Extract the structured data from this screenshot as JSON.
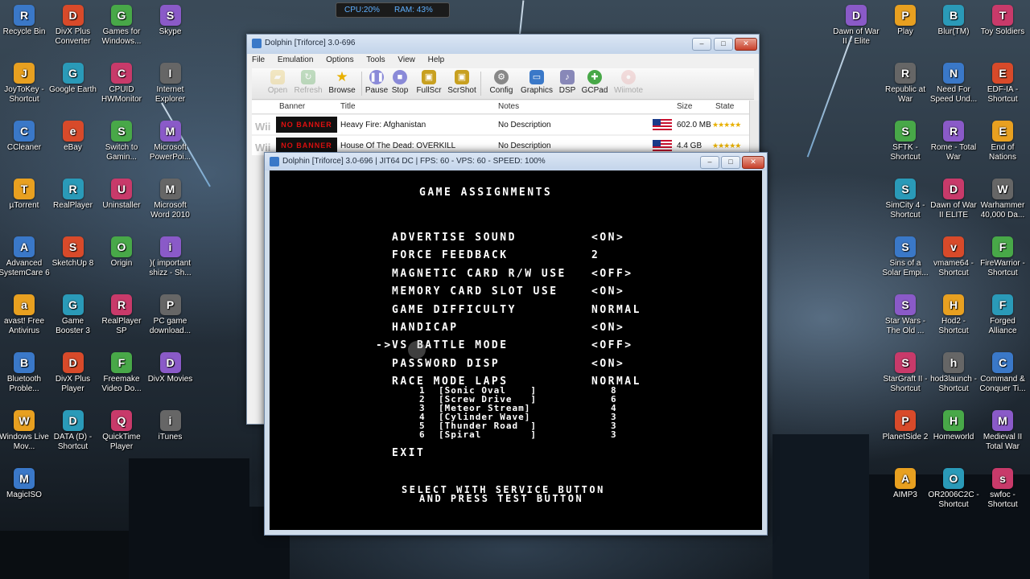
{
  "meter": {
    "cpu": "CPU:20%",
    "ram": "RAM: 43%"
  },
  "desktop_left": [
    [
      "Recycle Bin"
    ],
    [
      "DivX Plus Converter"
    ],
    [
      "Games for Windows..."
    ],
    [
      "Skype"
    ],
    [
      "JoyToKey - Shortcut"
    ],
    [
      "Google Earth"
    ],
    [
      "CPUID HWMonitor"
    ],
    [
      "Internet Explorer"
    ],
    [
      "CCleaner"
    ],
    [
      "eBay"
    ],
    [
      "Switch to Gamin..."
    ],
    [
      "Microsoft PowerPoi..."
    ],
    [
      "µTorrent"
    ],
    [
      "RealPlayer"
    ],
    [
      "Uninstaller"
    ],
    [
      "Microsoft Word 2010"
    ],
    [
      "Advanced SystemCare 6"
    ],
    [
      "SketchUp 8"
    ],
    [
      "Origin"
    ],
    [
      ")( important shizz - Sh..."
    ],
    [
      "avast! Free Antivirus"
    ],
    [
      "Game Booster 3"
    ],
    [
      "RealPlayer SP"
    ],
    [
      "PC game download..."
    ],
    [
      "Bluetooth Proble..."
    ],
    [
      "DivX Plus Player"
    ],
    [
      "Freemake Video Do..."
    ],
    [
      "DivX Movies"
    ],
    [
      "Windows Live Mov..."
    ],
    [
      "DATA (D) - Shortcut"
    ],
    [
      "QuickTime Player"
    ],
    [
      "iTunes"
    ],
    [
      "MagicISO"
    ]
  ],
  "desktop_right": [
    "Dawn of War II - Elite",
    "Play",
    "Blur(TM)",
    "Toy Soldiers",
    "Republic at War",
    "Need For Speed Und...",
    "EDF-IA - Shortcut",
    "SFTK - Shortcut",
    "Rome - Total War",
    "End of Nations",
    "SimCity 4 - Shortcut",
    "Dawn of War II ELITE",
    "Warhammer 40,000 Da...",
    "Sins of a Solar Empi...",
    "vmame64 - Shortcut",
    "FireWarrior - Shortcut",
    "Star Wars - The Old ...",
    "Hod2 - Shortcut",
    "Forged Alliance",
    "StarGraft II - Shortcut",
    "hod3launch - Shortcut",
    "Command & Conquer Ti...",
    "PlanetSide 2",
    "Homeworld",
    "Medieval II Total War",
    "AIMP3",
    "OR2006C2C - Shortcut",
    "swfoc - Shortcut"
  ],
  "main_window": {
    "title": "Dolphin [Triforce] 3.0-696",
    "menu": [
      "File",
      "Emulation",
      "Options",
      "Tools",
      "View",
      "Help"
    ],
    "toolbar": [
      "Open",
      "Refresh",
      "Browse",
      "Pause",
      "Stop",
      "FullScr",
      "ScrShot",
      "Config",
      "Graphics",
      "DSP",
      "GCPad",
      "Wiimote"
    ],
    "columns": {
      "banner": "Banner",
      "title": "Title",
      "notes": "Notes",
      "size": "Size",
      "state": "State"
    },
    "rows": [
      {
        "platform": "Wii",
        "banner": "NO BANNER",
        "title": "Heavy Fire: Afghanistan",
        "notes": "No Description",
        "size": "602.0 MB",
        "state": "★★★★★"
      },
      {
        "platform": "Wii",
        "banner": "NO BANNER",
        "title": "House Of The Dead: OVERKILL",
        "notes": "No Description",
        "size": "4.4 GB",
        "state": "★★★★★"
      }
    ]
  },
  "game_window": {
    "title": "Dolphin [Triforce] 3.0-696 | JIT64 DC | FPS: 60 - VPS: 60 - SPEED: 100%",
    "heading": "GAME ASSIGNMENTS",
    "settings": [
      {
        "label": "ADVERTISE SOUND",
        "value": "<ON>"
      },
      {
        "label": "FORCE FEEDBACK",
        "value": "2"
      },
      {
        "label": "MAGNETIC CARD R/W USE",
        "value": "<OFF>"
      },
      {
        "label": "MEMORY CARD SLOT USE",
        "value": "<ON>"
      },
      {
        "label": "GAME DIFFICULTY",
        "value": "NORMAL"
      },
      {
        "label": "HANDICAP",
        "value": "<ON>"
      },
      {
        "label": "VS BATTLE MODE",
        "value": "<OFF>"
      },
      {
        "label": "PASSWORD DISP",
        "value": "<ON>"
      },
      {
        "label": "RACE MODE LAPS",
        "value": "NORMAL"
      }
    ],
    "selector": "->",
    "laps": [
      {
        "num": "1",
        "course": "[Sonic Oval    ]",
        "laps": "8"
      },
      {
        "num": "2",
        "course": "[Screw Drive   ]",
        "laps": "6"
      },
      {
        "num": "3",
        "course": "[Meteor Stream]",
        "laps": "4"
      },
      {
        "num": "4",
        "course": "[Cylinder Wave]",
        "laps": "3"
      },
      {
        "num": "5",
        "course": "[Thunder Road  ]",
        "laps": "3"
      },
      {
        "num": "6",
        "course": "[Spiral        ]",
        "laps": "3"
      }
    ],
    "exit": "EXIT",
    "footer1": "SELECT WITH SERVICE BUTTON",
    "footer2": "AND PRESS TEST BUTTON"
  }
}
